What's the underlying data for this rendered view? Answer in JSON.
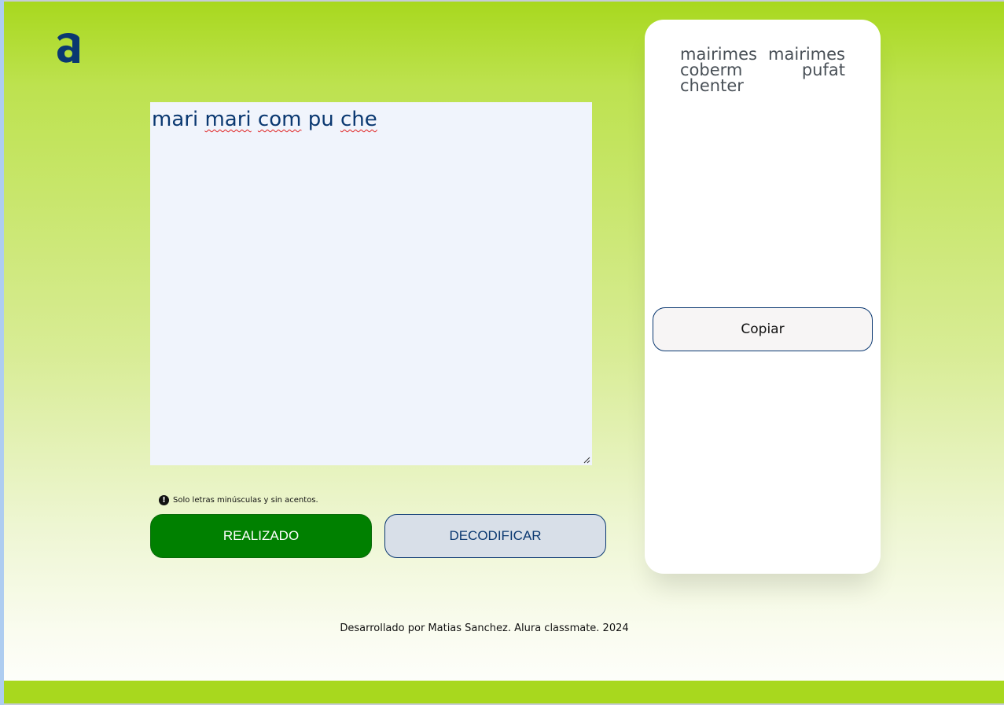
{
  "colors": {
    "accent": "#0a3871",
    "primary_button": "#008000",
    "secondary_button": "#d8dfe8",
    "gradient_top": "#a8d81e",
    "footer_bar": "#a8d81e"
  },
  "logo": {
    "icon": "alura-logo-icon"
  },
  "input": {
    "words": [
      "mari",
      "mari",
      "com",
      "pu",
      "che"
    ],
    "misspelled": [
      false,
      true,
      true,
      false,
      true
    ]
  },
  "hint": {
    "icon": "exclamation-circle-icon",
    "text": "Solo letras minúsculas y sin acentos."
  },
  "buttons": {
    "encrypt_label": "REALIZADO",
    "decrypt_label": "DECODIFICAR"
  },
  "output": {
    "text": "mairimes mairimes coberm pufat chenter",
    "copy_label": "Copiar"
  },
  "footer": {
    "text": "Desarrollado por Matias Sanchez. Alura classmate. 2024"
  }
}
